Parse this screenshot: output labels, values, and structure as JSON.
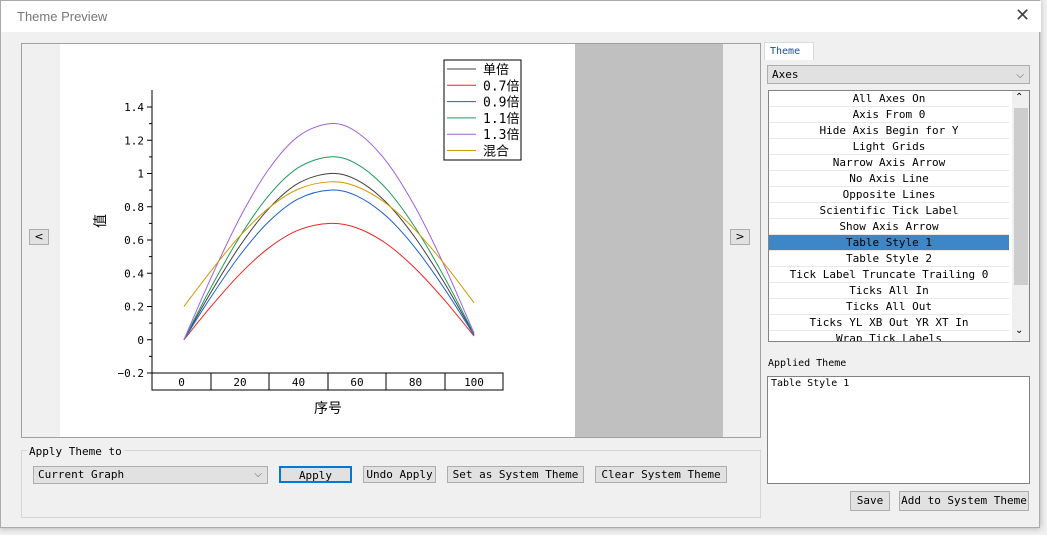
{
  "window": {
    "title": "Theme Preview",
    "close_icon": "close-icon"
  },
  "preview": {
    "prev_icon": "chevron-left-icon",
    "next_icon": "chevron-right-icon",
    "prev": "<",
    "next": ">"
  },
  "chart_data": {
    "type": "line",
    "xlabel": "序号",
    "ylabel": "值",
    "xlim": [
      0,
      100
    ],
    "ylim": [
      -0.2,
      1.5
    ],
    "xticks": [
      "0",
      "20",
      "40",
      "60",
      "80",
      "100"
    ],
    "yticks": [
      "1.4",
      "1.2",
      "1",
      "0.8",
      "0.6",
      "0.4",
      "0.2",
      "0",
      "−0.2"
    ],
    "ytick_values": [
      1.4,
      1.2,
      1,
      0.8,
      0.6,
      0.4,
      0.2,
      0,
      -0.2
    ],
    "xaxis_style": "table",
    "legend_position": "top-right",
    "x": [
      1,
      10,
      20,
      30,
      40,
      51,
      60,
      70,
      80,
      90,
      100
    ],
    "series": [
      {
        "name": "单倍",
        "color": "#404040",
        "values": [
          0,
          0.279,
          0.562,
          0.79,
          0.941,
          1.0,
          0.961,
          0.827,
          0.612,
          0.339,
          0.031
        ]
      },
      {
        "name": "0.7倍",
        "color": "#ee2222",
        "values": [
          0,
          0.195,
          0.393,
          0.553,
          0.659,
          0.7,
          0.673,
          0.579,
          0.428,
          0.237,
          0.022
        ]
      },
      {
        "name": "0.9倍",
        "color": "#1a5fd8",
        "values": [
          0,
          0.251,
          0.506,
          0.711,
          0.847,
          0.9,
          0.865,
          0.744,
          0.551,
          0.305,
          0.028
        ]
      },
      {
        "name": "1.1倍",
        "color": "#1e9a5a",
        "values": [
          0,
          0.307,
          0.618,
          0.869,
          1.035,
          1.1,
          1.057,
          0.91,
          0.673,
          0.373,
          0.034
        ]
      },
      {
        "name": "1.3倍",
        "color": "#a060e0",
        "values": [
          0,
          0.363,
          0.731,
          1.027,
          1.223,
          1.3,
          1.249,
          1.075,
          0.796,
          0.441,
          0.04
        ]
      },
      {
        "name": "混合",
        "color": "#d09a00",
        "values": [
          0.2,
          0.409,
          0.622,
          0.793,
          0.906,
          0.95,
          0.921,
          0.82,
          0.659,
          0.454,
          0.223
        ]
      }
    ]
  },
  "theme_panel": {
    "tab": "Theme",
    "category": "Axes",
    "items": [
      "All Axes On",
      "Axis From 0",
      "Hide Axis Begin for Y",
      "Light Grids",
      "Narrow Axis Arrow",
      "No Axis Line",
      "Opposite Lines",
      "Scientific Tick Label",
      "Show Axis Arrow",
      "Table Style 1",
      "Table Style 2",
      "Tick Label Truncate Trailing 0",
      "Ticks All In",
      "Ticks All Out",
      "Ticks YL XB Out YR XT In",
      "Wrap Tick Labels"
    ],
    "selected_index": 9,
    "selected_color": "#3d87c9",
    "applied_label": "Applied Theme",
    "applied_value": "Table Style 1",
    "save": "Save",
    "add_system": "Add to System Theme"
  },
  "apply": {
    "group_label": "Apply Theme to",
    "target": "Current Graph",
    "apply": "Apply",
    "undo": "Undo Apply",
    "set_system": "Set as System Theme",
    "clear_system": "Clear System Theme"
  }
}
